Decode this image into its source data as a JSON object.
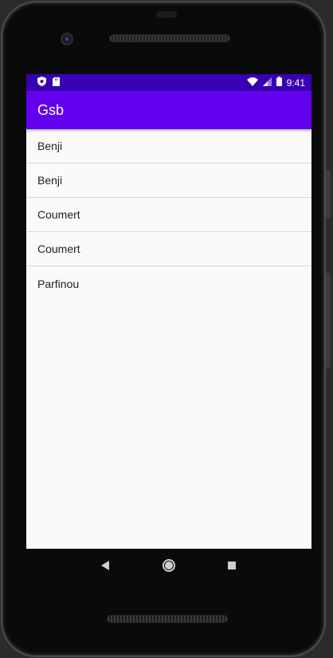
{
  "status_bar": {
    "time": "9:41",
    "icons_left": [
      "shield-icon",
      "sd-card-icon"
    ],
    "icons_right": [
      "wifi-icon",
      "cell-signal-icon",
      "battery-icon"
    ],
    "color": "#3700b3"
  },
  "app_bar": {
    "title": "Gsb",
    "color": "#6200ee"
  },
  "list": {
    "items": [
      {
        "label": "Benji"
      },
      {
        "label": "Benji"
      },
      {
        "label": "Coumert"
      },
      {
        "label": "Coumert"
      },
      {
        "label": "Parfinou"
      }
    ]
  },
  "nav_bar": {
    "buttons": [
      "back-icon",
      "home-icon",
      "recents-icon"
    ]
  }
}
